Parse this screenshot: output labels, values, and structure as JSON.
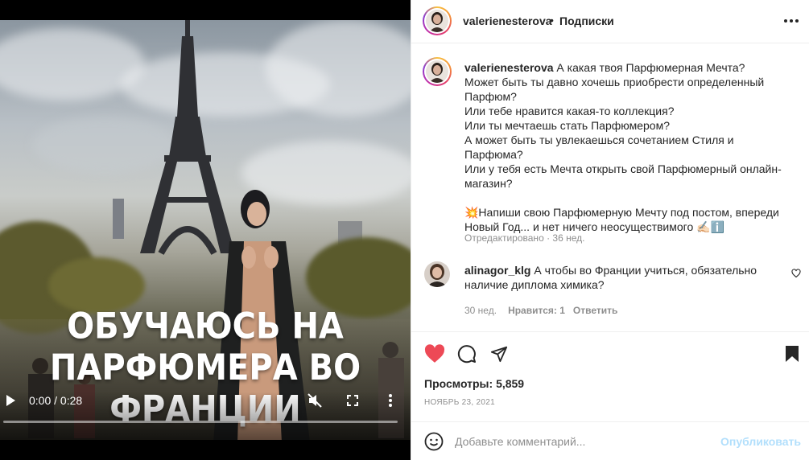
{
  "video": {
    "overlay_line1": "ОБУЧАЮСЬ НА",
    "overlay_line2": "ПАРФЮМЕРА ВО ФРАНЦИИ",
    "time": "0:00 / 0:28",
    "progress": 0.0,
    "icons": [
      "play-icon",
      "mute-icon",
      "fullscreen-icon",
      "more-vertical-icon"
    ]
  },
  "header": {
    "username": "valerienesterova",
    "separator": "•",
    "follow_label": "Подписки",
    "more_icon": "more-horizontal-icon"
  },
  "caption": {
    "username": "valerienesterova",
    "lines": [
      "А какая твоя Парфюмерная Мечта?",
      "Может быть ты давно хочешь приобрести определенный",
      "Парфюм?",
      "Или тебе нравится какая-то коллекция?",
      "Или ты мечтаешь стать Парфюмером?",
      "А может быть ты увлекаешься сочетанием Стиля и Парфюма?",
      "Или у тебя есть Мечта открыть свой Парфюмерный онлайн-",
      "магазин?"
    ],
    "cta_line1": "💥Напиши свою Парфюмерную Мечту под постом, впереди",
    "cta_line2": "Новый Год... и нет ничего неосуществимого ✍🏻ℹ️",
    "meta": "Отредактировано · 36 нед."
  },
  "comment": {
    "username": "alinagor_klg",
    "line1": "А чтобы во Франции учиться, обязательно",
    "line2": "наличие диплома химика?",
    "time": "30 нед.",
    "likes": "Нравится: 1",
    "reply": "Ответить"
  },
  "actions": {
    "views_label": "Просмотры:",
    "views_count": "5,859",
    "date": "НОЯБРЬ 23, 2021",
    "like_color": "#ed4956"
  },
  "add_comment": {
    "placeholder": "Добавьте комментарий...",
    "publish_label": "Опубликовать"
  }
}
